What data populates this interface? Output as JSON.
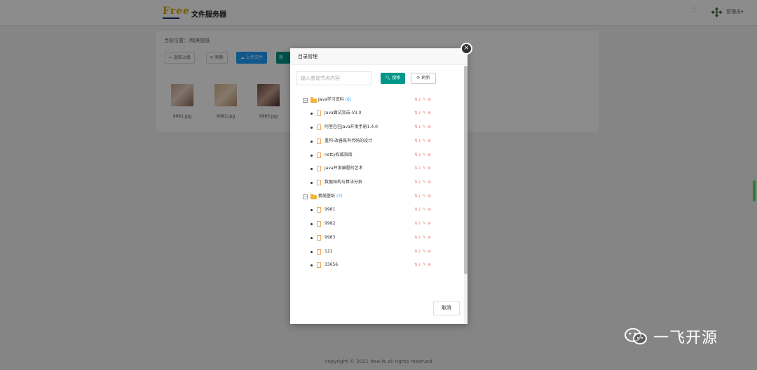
{
  "header": {
    "logo": "Free",
    "title": "文件服务器",
    "user": "管理员▾"
  },
  "content": {
    "breadcrumb": "当前位置：/精美壁纸",
    "toolbar": {
      "back": "← 返回上级",
      "refresh": "⟳ 刷新",
      "upload": "☁ 上传文件",
      "new": "新"
    },
    "files": [
      {
        "name": "9981.jpg"
      },
      {
        "name": "9982.jpg"
      },
      {
        "name": "9983.jpg"
      }
    ]
  },
  "footer": {
    "text": "copyright © 2021 free-fs all rights reserved"
  },
  "modal": {
    "title": "目录管理",
    "close": "×",
    "search_placeholder": "输入查询节点内容",
    "search_button": "搜索",
    "refresh_button": "刷新",
    "cancel_button": "取消",
    "action_icons": "⇅↓ ✎ ⊗",
    "tree": [
      {
        "type": "folder",
        "label": "Java学习资料",
        "count": "(6)"
      },
      {
        "type": "file",
        "label": "Java面试突击-V3.0"
      },
      {
        "type": "file",
        "label": "阿里巴巴Java开发手册1.4.0"
      },
      {
        "type": "file",
        "label": "重构-改善既有代码的设计"
      },
      {
        "type": "file",
        "label": "netty权威指南"
      },
      {
        "type": "file",
        "label": "java并发编程的艺术"
      },
      {
        "type": "file",
        "label": "数据结构与算法分析"
      },
      {
        "type": "folder",
        "label": "精美壁纸",
        "count": "(7)"
      },
      {
        "type": "file",
        "label": "9981"
      },
      {
        "type": "file",
        "label": "9982"
      },
      {
        "type": "file",
        "label": "9983"
      },
      {
        "type": "file",
        "label": "121"
      },
      {
        "type": "file",
        "label": "33656"
      }
    ]
  },
  "watermark": {
    "text": "一飞开源"
  },
  "colors": {
    "primary": "#009688",
    "blue": "#1e9fff",
    "folder": "#f4b33a",
    "action": "#f58a8a"
  }
}
